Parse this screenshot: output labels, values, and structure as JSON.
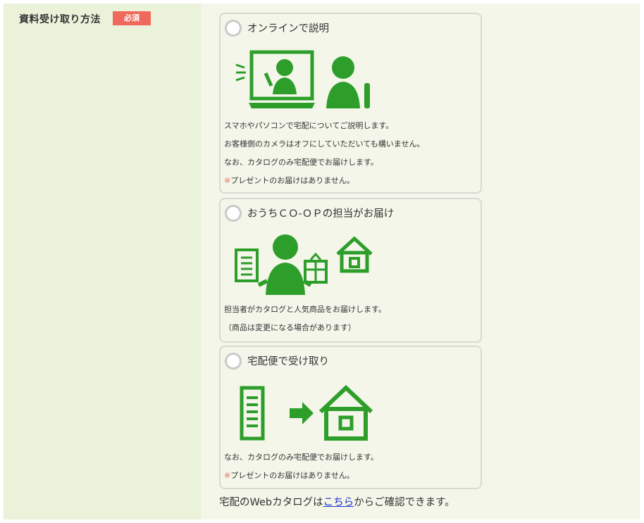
{
  "field": {
    "label": "資料受け取り方法",
    "required_badge": "必須"
  },
  "options": [
    {
      "title": "オンラインで説明",
      "lines": [
        "スマホやパソコンで宅配についてご説明します。",
        "お客様側のカメラはオフにしていただいても構いません。",
        "なお、カタログのみ宅配便でお届けします。"
      ],
      "note_mark": "※",
      "note_text": "プレゼントのお届けはありません。"
    },
    {
      "title": "おうちＣＯ-ＯＰの担当がお届け",
      "lines": [
        "担当者がカタログと人気商品をお届けします。",
        "（商品は変更になる場合があります）"
      ]
    },
    {
      "title": "宅配便で受け取り",
      "lines": [
        "なお、カタログのみ宅配便でお届けします。"
      ],
      "note_mark": "※",
      "note_text": "プレゼントのお届けはありません。"
    }
  ],
  "footer": {
    "before": "宅配のWebカタログは",
    "link": "こちら",
    "after": "からご確認できます。"
  },
  "colors": {
    "illustration_green": "#2e9e2b",
    "badge_red": "#ef6a5c",
    "label_bg": "#eaf2da",
    "content_bg": "#f3f6e9",
    "link_blue": "#1a2fd0"
  },
  "icons": [
    "laptop-video-call-icon",
    "person-icon",
    "catalog-icon",
    "staff-with-gift-icon",
    "house-icon",
    "arrow-right-icon"
  ]
}
